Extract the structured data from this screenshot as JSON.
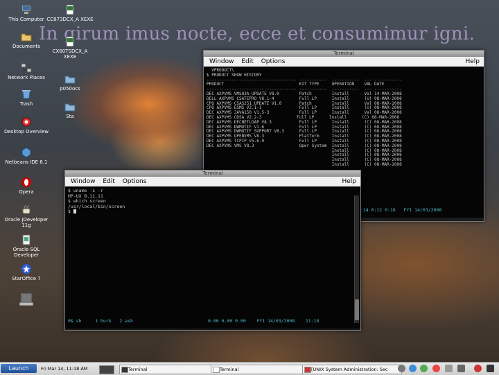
{
  "desktop": {
    "motto": "In girum imus nocte, ecce et consumimur igni.",
    "icons": [
      {
        "label": "This Computer",
        "icon": "computer-icon"
      },
      {
        "label": "Documents",
        "icon": "folder-icon"
      },
      {
        "label": "Network Places",
        "icon": "network-icon"
      },
      {
        "label": "Trash",
        "icon": "trash-icon"
      },
      {
        "label": "Desktop Overview",
        "icon": "desktop-overview-icon"
      },
      {
        "label": "Netbeans IDE 6.1",
        "icon": "netbeans-icon"
      },
      {
        "label": "Opera",
        "icon": "opera-icon"
      },
      {
        "label": "Oracle JDeveloper 11g",
        "icon": "jdeveloper-icon"
      },
      {
        "label": "Oracle SQL Developer",
        "icon": "sqldeveloper-icon"
      },
      {
        "label": "StarOffice 7",
        "icon": "staroffice-icon"
      },
      {
        "label": "",
        "icon": "drive-icon"
      },
      {
        "label": "CC873DCX_A XEXE",
        "icon": "document-icon"
      },
      {
        "label": "CX60TSDCX_A XEXE",
        "icon": "document-icon"
      },
      {
        "label": "p050ocs",
        "icon": "folder-icon"
      },
      {
        "label": "Sta",
        "icon": "folder-icon"
      }
    ]
  },
  "window_back": {
    "title": "Terminal",
    "menu": {
      "window": "Window",
      "edit": "Edit",
      "options": "Options",
      "help": "Help"
    },
    "lines": [
      "  VPRODUCT\\",
      "$ PRODUCT SHOW HISTORY",
      "------------------------------------ -----------  -----------  --- -----------",
      "PRODUCT                              KIT TYPE     OPERATION    VAL DATE",
      "------------------------------------ -----------  -----------  --- -----------",
      "DEC AXPVMS VMS83A_UPDATE V8.0        Patch        Install      Val 14-MAR-2008",
      "DELL AXPVMS CSATEPRO V8.1-4          Full LP      Install      (U) 08-MAR-2008",
      "CPQ AXPVMS CSAS251_UPDATE V1.0       Patch        Install      Val 08-MAR-2008",
      "CPQ AXPVMS ESMS V2.1-1               Full LP      Install      (U) 08-MAR-2008",
      "DEC AXPVMS JAVA150 V1.5-3            Full LP      Install      Val 08-MAR-2008",
      "DEC AXPVMS CDSA V2.2-3              Full LP      Install      (C) 08-MAR-2008",
      "DEC AXPVMS DECNETLDAP V8.3           Full LP      Install      (C) 08-MAR-2008",
      "DEC AXPVMS DWMOTIF V1.6              Full LP      Install      (C) 08-MAR-2008",
      "DEC AXPVMS DWMOTIF_SUPPORT V8.3      Full LP      Install      (C) 08-MAR-2008",
      "DEC AXPVMS OPENVMS V8.3              Platform     Install      (C) 08-MAR-2008",
      "DEC AXPVMS TCPIP V5.6-9              Full LP      Install      (C) 08-MAR-2008",
      "DEC AXPVMS VMS V8.3                  Oper System  Install      (C) 08-MAR-2008",
      "                                                  Install      (C) 08-MAR-2008",
      "                                                  Install      (C) 08-MAR-2008",
      "                                                  Install      (C) 08-MAR-2008",
      "                                                  Install      (C) 08-MAR-2008"
    ],
    "status": "0:14 0:12 0:16   FY1 14/03/2008"
  },
  "window_front": {
    "title": "Terminal",
    "menu": {
      "window": "Window",
      "edit": "Edit",
      "options": "Options",
      "help": "Help"
    },
    "lines": [
      "$ uname -s -r",
      "HP-UX B.11.11",
      "$ which screen",
      "/usr/local/bin/screen",
      "$ "
    ],
    "status_left": "0$ sh     1 hurk   2 ash",
    "status_right": "0.00 0.00 0.00    FY1 14/03/2008    11:18"
  },
  "taskbar": {
    "launch": "Launch",
    "clock": "Fri Mar 14, 11:18 AM",
    "tasks": [
      "Terminal",
      "Terminal",
      "[UNIX System Administration: Sec"
    ]
  }
}
